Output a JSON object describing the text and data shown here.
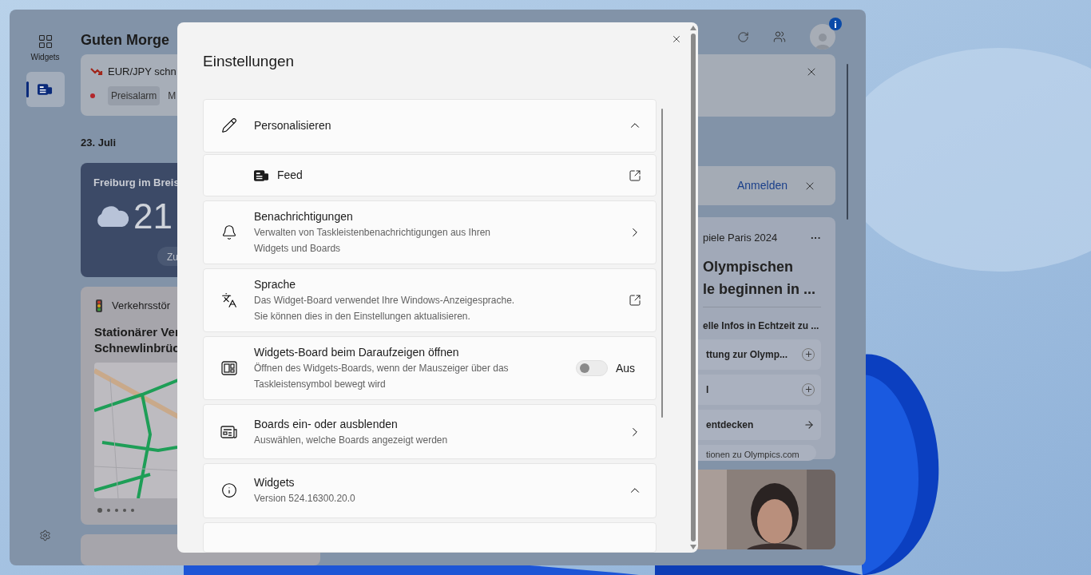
{
  "widget_board": {
    "rail": [
      {
        "kind": "widgets",
        "label": "Widgets",
        "selected": false
      },
      {
        "kind": "feed",
        "selected": true
      }
    ],
    "greeting": "Guten Morge",
    "alert": {
      "title": "EUR/JPY schn",
      "chips": [
        "Preisalarm",
        "M"
      ]
    },
    "date": "23. Juli",
    "weather": {
      "location": "Freiburg im Breis",
      "temperature": "21",
      "button": "Zu"
    },
    "traffic": {
      "source": "Verkehrsstör",
      "headline_lines": [
        "Stationärer Ver",
        "Schnewlinbrüc"
      ],
      "pages": [
        {
          "selected": true
        },
        {
          "selected": false
        },
        {
          "selected": false
        },
        {
          "selected": false
        },
        {
          "selected": false
        }
      ]
    },
    "sign_in": {
      "link": "Anmelden"
    },
    "olympics": {
      "source": "piele Paris 2024",
      "more": "···",
      "title_lines": [
        "Olympischen",
        "le beginnen in ..."
      ],
      "subtitle": "elle Infos in Echtzeit zu ...",
      "rows": [
        {
          "kind": "add",
          "label": "ttung zur Olymp..."
        },
        {
          "kind": "add",
          "label": "l"
        },
        {
          "kind": "arrow",
          "label": "entdecken"
        }
      ],
      "chip": "tionen zu Olympics.com"
    }
  },
  "settings_dialog": {
    "title": "Einstellungen",
    "sections": [
      {
        "kind": "expander",
        "title": "Personalisieren",
        "expanded": true,
        "children": [
          {
            "kind": "link",
            "title": "Feed"
          }
        ]
      },
      {
        "kind": "nav",
        "title": "Benachrichtigungen",
        "description_lines": [
          "Verwalten von Taskleistenbenachrichtigungen aus Ihren",
          "Widgets und Boards"
        ]
      },
      {
        "kind": "link",
        "title": "Sprache",
        "description_lines": [
          "Das Widget-Board verwendet Ihre Windows-Anzeigesprache.",
          "Sie können dies in den Einstellungen aktualisieren."
        ]
      },
      {
        "kind": "toggle",
        "title": "Widgets-Board beim Daraufzeigen öffnen",
        "description_lines": [
          "Öffnen des Widgets-Boards, wenn der Mauszeiger über das",
          "Taskleistensymbol bewegt wird"
        ],
        "on": false,
        "state_label": "Aus"
      },
      {
        "kind": "nav",
        "title": "Boards ein- oder ausblenden",
        "description_lines": [
          "Auswählen, welche Boards angezeigt werden"
        ]
      },
      {
        "kind": "expander",
        "title": "Widgets",
        "description_lines": [
          "Version 524.16300.20.0"
        ],
        "expanded": true
      }
    ]
  }
}
